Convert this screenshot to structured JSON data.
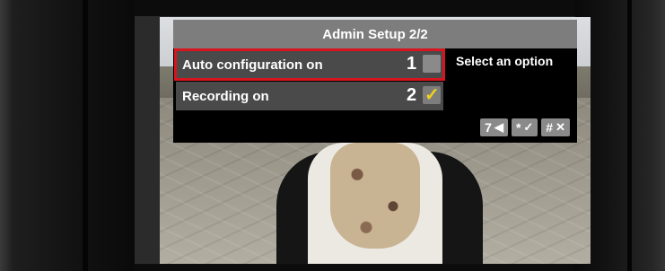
{
  "title": "Admin Setup 2/2",
  "rows": [
    {
      "label": "Auto configuration on",
      "number": "1",
      "checked": false,
      "selected": true
    },
    {
      "label": "Recording on",
      "number": "2",
      "checked": true,
      "selected": false
    }
  ],
  "hint": "Select an option",
  "nav": [
    {
      "key": "7",
      "icon": "back-arrow-icon",
      "glyph": "◀"
    },
    {
      "key": "*",
      "icon": "confirm-check-icon",
      "glyph": "✓"
    },
    {
      "key": "#",
      "icon": "cancel-x-icon",
      "glyph": "✕"
    }
  ],
  "colors": {
    "selection_outline": "#d8141e",
    "check_color": "#f2d21a",
    "title_bar": "#7d7d7d",
    "row_bg": "#4a4a4a"
  }
}
